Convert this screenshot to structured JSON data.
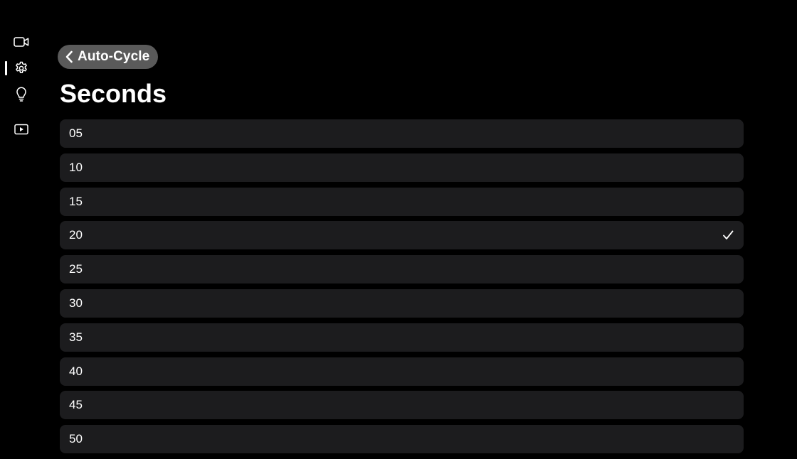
{
  "sidebar": {
    "items": [
      {
        "name": "video-camera",
        "icon": "video-camera-icon"
      },
      {
        "name": "settings",
        "icon": "gear-icon",
        "active": true
      },
      {
        "name": "tips",
        "icon": "lightbulb-icon"
      },
      {
        "name": "playback",
        "icon": "play-rectangle-icon"
      }
    ]
  },
  "header": {
    "back_label": "Auto-Cycle",
    "title": "Seconds"
  },
  "options": [
    {
      "label": "05",
      "selected": false
    },
    {
      "label": "10",
      "selected": false
    },
    {
      "label": "15",
      "selected": false
    },
    {
      "label": "20",
      "selected": true
    },
    {
      "label": "25",
      "selected": false
    },
    {
      "label": "30",
      "selected": false
    },
    {
      "label": "35",
      "selected": false
    },
    {
      "label": "40",
      "selected": false
    },
    {
      "label": "45",
      "selected": false
    },
    {
      "label": "50",
      "selected": false
    }
  ],
  "colors": {
    "background": "#000000",
    "row": "#1c1c1e",
    "back_button": "#5a5a5a",
    "text": "#ffffff"
  }
}
